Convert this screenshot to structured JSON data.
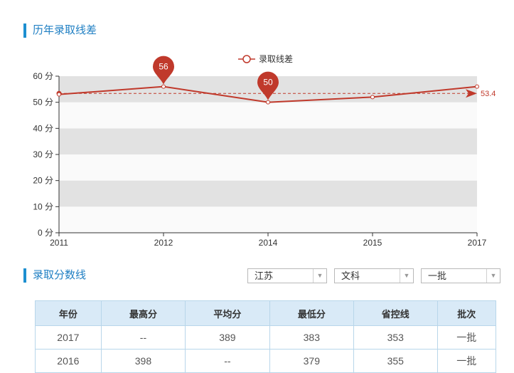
{
  "section1": {
    "title": "历年录取线差"
  },
  "section2": {
    "title": "录取分数线"
  },
  "chart_data": {
    "type": "line",
    "legend": "录取线差",
    "x": [
      "2011",
      "2012",
      "2014",
      "2015",
      "2017"
    ],
    "series": [
      {
        "name": "录取线差",
        "values": [
          53,
          56,
          50,
          52,
          56
        ]
      }
    ],
    "y_ticks": [
      "0 分",
      "10 分",
      "20 分",
      "30 分",
      "40 分",
      "50 分",
      "60 分"
    ],
    "ylim": [
      0,
      60
    ],
    "average": {
      "value": 53.4,
      "label": "53.4"
    },
    "max_pin": {
      "index": 1,
      "label": "56"
    },
    "min_pin": {
      "index": 2,
      "label": "50"
    },
    "colors": {
      "line": "#c0392b",
      "band_dark": "#e2e2e2",
      "band_light": "#fafafa"
    }
  },
  "filters": {
    "province": "江苏",
    "subject": "文科",
    "batch": "一批"
  },
  "table": {
    "headers": [
      "年份",
      "最高分",
      "平均分",
      "最低分",
      "省控线",
      "批次"
    ],
    "rows": [
      [
        "2017",
        "--",
        "389",
        "383",
        "353",
        "一批"
      ],
      [
        "2016",
        "398",
        "--",
        "379",
        "355",
        "一批"
      ]
    ]
  }
}
